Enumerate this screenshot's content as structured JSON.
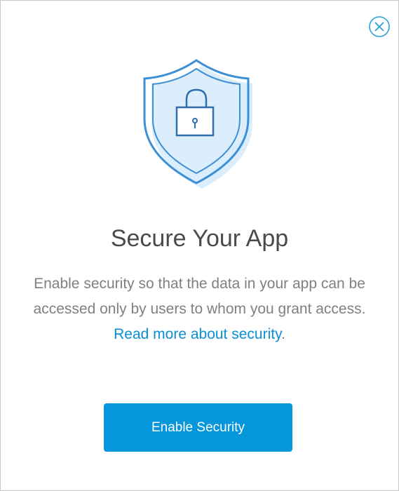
{
  "dialog": {
    "title": "Secure Your App",
    "description_text": "Enable security so that the data in your app can be accessed only by users to whom you grant access. ",
    "link_text": "Read more about security",
    "description_suffix": ".",
    "button_label": "Enable Security"
  },
  "icons": {
    "close": "close-icon",
    "hero": "shield-lock-icon"
  },
  "colors": {
    "accent": "#0596dc",
    "link": "#0a8fd4",
    "shield_outline": "#3d8fd6",
    "shield_fill": "#d9ecfb",
    "title_text": "#4a4a4a",
    "body_text": "#808080"
  }
}
